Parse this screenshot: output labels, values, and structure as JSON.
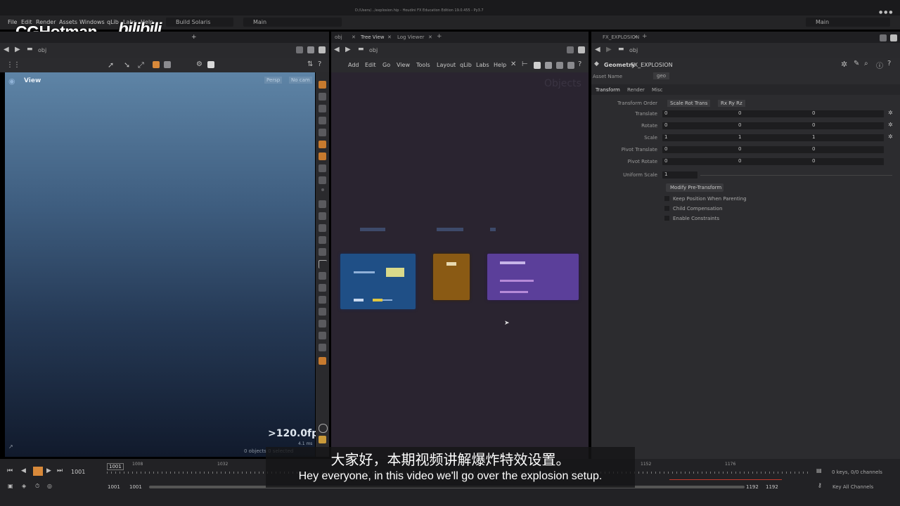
{
  "window": {
    "title": "D:/Users/.../explosion.hip - Houdini FX Education Edition 19.0.455 - Py3.7"
  },
  "menu": {
    "items": [
      "File",
      "Edit",
      "Render",
      "Assets",
      "Windows",
      "qLib",
      "Labs",
      "Help"
    ],
    "desktop": "Build Solaris",
    "context": "Main",
    "right_context": "Main"
  },
  "watermark": {
    "text": "CGHotman",
    "logo": "bilibili"
  },
  "left_pane": {
    "path": "obj",
    "viewport_label": "View",
    "cam_label": "Persp",
    "cam2_label": "No cam",
    "fps": ">120.0fps",
    "fps_sub": "4.1 ms",
    "status": "0 objects  0 selected"
  },
  "center_pane": {
    "tabs": [
      "obj",
      "Tree View",
      "Log Viewer"
    ],
    "path": "obj",
    "menu": [
      "Add",
      "Edit",
      "Go",
      "View",
      "Tools",
      "Layout",
      "qLib",
      "Labs",
      "Help"
    ],
    "watermark": "Objects"
  },
  "right_pane": {
    "tab": "FX_EXPLOSION",
    "path": "obj",
    "node_type": "Geometry",
    "node_name": "FX_EXPLOSION",
    "asset_name_label": "Asset Name",
    "asset_name_value": "geo",
    "tabs": [
      "Transform",
      "Render",
      "Misc"
    ],
    "transform_order_label": "Transform Order",
    "transform_order_value": "Scale Rot Trans",
    "rotate_order_value": "Rx Ry Rz",
    "rows": [
      {
        "label": "Translate",
        "values": [
          "0",
          "0",
          "0"
        ]
      },
      {
        "label": "Rotate",
        "values": [
          "0",
          "0",
          "0"
        ]
      },
      {
        "label": "Scale",
        "values": [
          "1",
          "1",
          "1"
        ]
      },
      {
        "label": "Pivot Translate",
        "values": [
          "0",
          "0",
          "0"
        ]
      },
      {
        "label": "Pivot Rotate",
        "values": [
          "0",
          "0",
          "0"
        ]
      }
    ],
    "uniform_scale_label": "Uniform Scale",
    "uniform_scale_value": "1",
    "modify_button": "Modify Pre-Transform",
    "checkboxes": [
      "Keep Position When Parenting",
      "Child Compensation",
      "Enable Constraints"
    ]
  },
  "timeline": {
    "frame": "1001",
    "start": "1001",
    "start2": "1001",
    "end": "1192",
    "end2": "1192",
    "ticks": [
      "1001",
      "1008",
      "1032",
      "1152",
      "1176"
    ],
    "keys_label": "0 keys, 0/0 channels",
    "key_all_label": "Key All Channels"
  },
  "subtitles": {
    "cn": "大家好，本期视频讲解爆炸特效设置。",
    "en": "Hey everyone, in this video we'll go over the explosion setup."
  },
  "colors": {
    "node_blue": "#1f4f86",
    "node_orange": "#8a5a14",
    "node_purple": "#5b3f9a",
    "accent": "#e07a2a"
  }
}
